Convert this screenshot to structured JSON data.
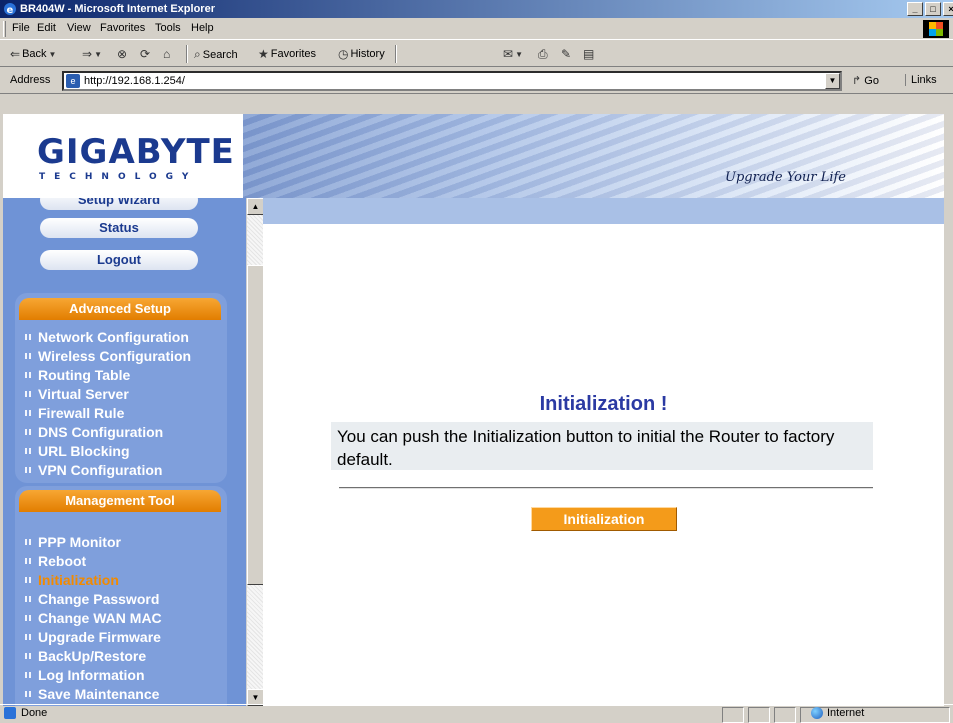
{
  "window": {
    "title": "BR404W - Microsoft Internet Explorer",
    "buttons": [
      "_",
      "□",
      "×"
    ]
  },
  "menubar": [
    "File",
    "Edit",
    "View",
    "Favorites",
    "Tools",
    "Help"
  ],
  "toolbar": {
    "back": "Back",
    "search": "Search",
    "favorites": "Favorites",
    "history": "History"
  },
  "addressbar": {
    "label": "Address",
    "url": "http://192.168.1.254/",
    "go": "Go",
    "links": "Links"
  },
  "banner": {
    "logo": "GIGABYTE",
    "logo_sub": "TECHNOLOGY",
    "tagline": "Upgrade Your Life"
  },
  "sidebar": {
    "buttons": [
      "Setup Wizard",
      "Status",
      "Logout"
    ],
    "advanced_setup": {
      "header": "Advanced Setup",
      "items": [
        "Network Configuration",
        "Wireless Configuration",
        "Routing Table",
        "Virtual Server",
        "Firewall Rule",
        "DNS Configuration",
        "URL Blocking",
        "VPN Configuration"
      ]
    },
    "management_tool": {
      "header": "Management Tool",
      "items": [
        "PPP Monitor",
        "Reboot",
        "Initialization",
        "Change Password",
        "Change WAN MAC",
        "Upgrade Firmware",
        "BackUp/Restore",
        "Log Information",
        "Save Maintenance"
      ],
      "active": "Initialization"
    }
  },
  "main": {
    "title": "Initialization !",
    "message": "You can push the Initialization button to initial the Router to factory default.",
    "button": "Initialization"
  },
  "statusbar": {
    "status": "Done",
    "zone": "Internet"
  }
}
